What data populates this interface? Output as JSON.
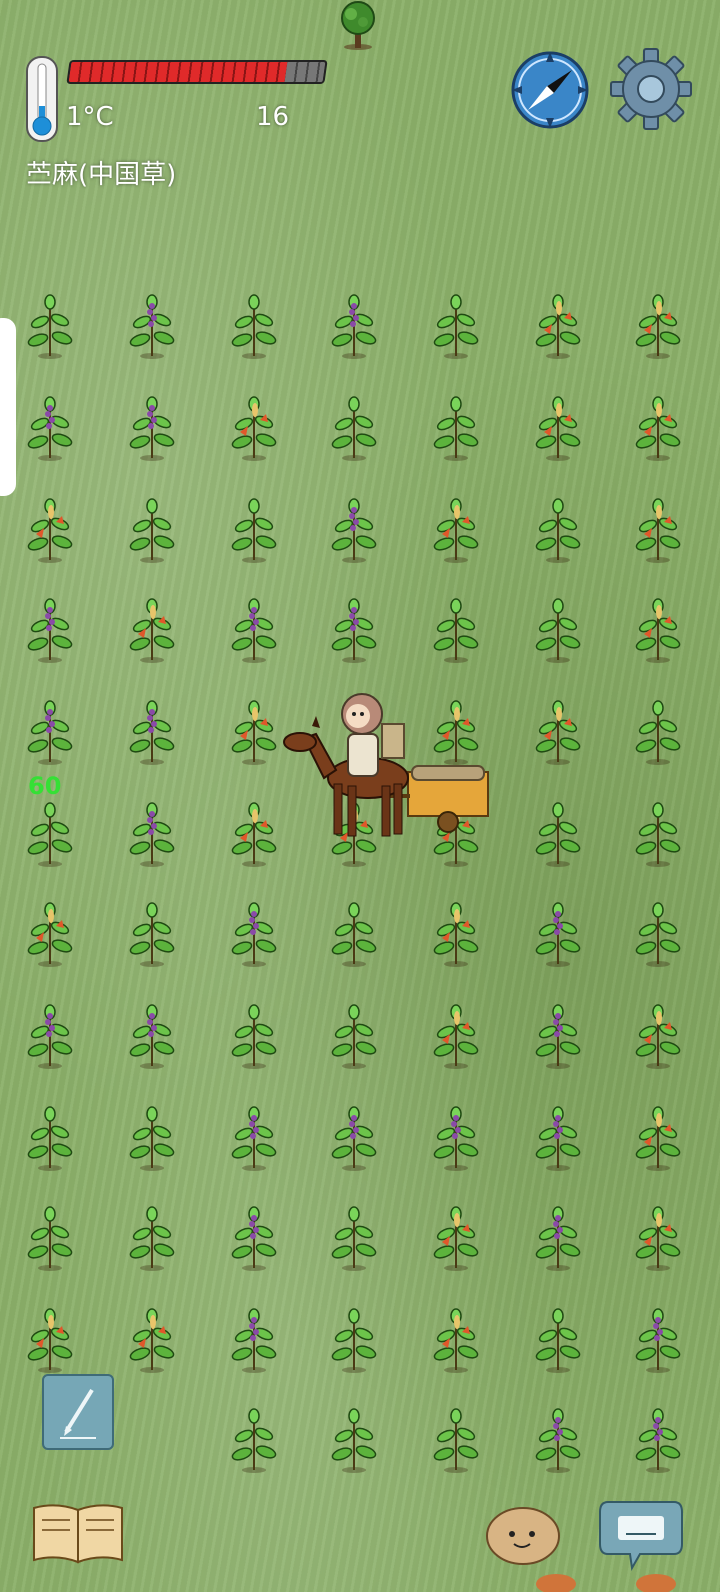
{
  "hud": {
    "temperature": "1°C",
    "count": "16",
    "object_name": "苎麻(中国草)",
    "food_level": 0.85,
    "floating_number": "60"
  },
  "colors": {
    "health_fill": "#e02a2a",
    "health_empty": "#777777",
    "grass": "#8bb069",
    "floating_number": "#35e035"
  },
  "icons": {
    "thermometer": "thermometer-icon",
    "compass": "compass-icon",
    "settings": "gear-icon",
    "pen": "pen-icon",
    "book": "book-icon",
    "emote": "potato-face-icon",
    "keyboard": "keyboard-icon"
  },
  "field": {
    "rows": [
      [
        "g",
        "p",
        "g",
        "p",
        "g",
        "o",
        "o"
      ],
      [
        "p",
        "p",
        "o",
        "g",
        "g",
        "o",
        "o"
      ],
      [
        "o",
        "g",
        "g",
        "p",
        "o",
        "g",
        "o"
      ],
      [
        "p",
        "o",
        "p",
        "p",
        "g",
        "g",
        "o"
      ],
      [
        "p",
        "p",
        "o",
        "",
        "o",
        "o",
        "g"
      ],
      [
        "g",
        "p",
        "o",
        "o",
        "o",
        "g",
        "g"
      ],
      [
        "o",
        "g",
        "p",
        "g",
        "o",
        "p",
        "g"
      ],
      [
        "p",
        "p",
        "g",
        "g",
        "o",
        "p",
        "o"
      ],
      [
        "g",
        "g",
        "p",
        "p",
        "p",
        "p",
        "o"
      ],
      [
        "g",
        "g",
        "p",
        "g",
        "o",
        "p",
        "o"
      ],
      [
        "o",
        "o",
        "p",
        "g",
        "o",
        "g",
        "p"
      ],
      [
        "",
        "",
        "g",
        "g",
        "g",
        "p",
        "p"
      ]
    ]
  }
}
